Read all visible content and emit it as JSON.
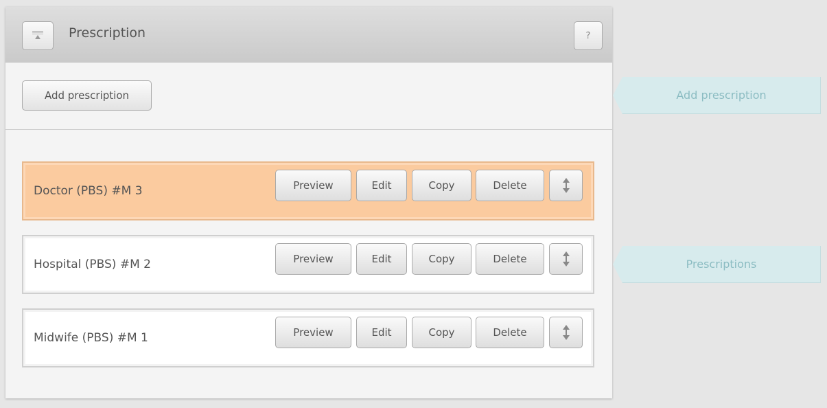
{
  "panel": {
    "title": "Prescription",
    "help_label": "?",
    "collapse_icon": "collapse-up-icon",
    "add_button_label": "Add prescription"
  },
  "prescriptions": [
    {
      "label": "Doctor (PBS) #M 3",
      "highlighted": true,
      "buttons": {
        "preview": "Preview",
        "edit": "Edit",
        "copy": "Copy",
        "delete": "Delete"
      }
    },
    {
      "label": "Hospital (PBS) #M 2",
      "highlighted": false,
      "buttons": {
        "preview": "Preview",
        "edit": "Edit",
        "copy": "Copy",
        "delete": "Delete"
      }
    },
    {
      "label": "Midwife (PBS) #M 1",
      "highlighted": false,
      "buttons": {
        "preview": "Preview",
        "edit": "Edit",
        "copy": "Copy",
        "delete": "Delete"
      }
    }
  ],
  "callouts": {
    "add": "Add prescription",
    "list": "Prescriptions"
  },
  "colors": {
    "highlight_row": "#fbcb9f",
    "callout_bg": "#d7ebed",
    "callout_text": "#8bbcc2"
  }
}
